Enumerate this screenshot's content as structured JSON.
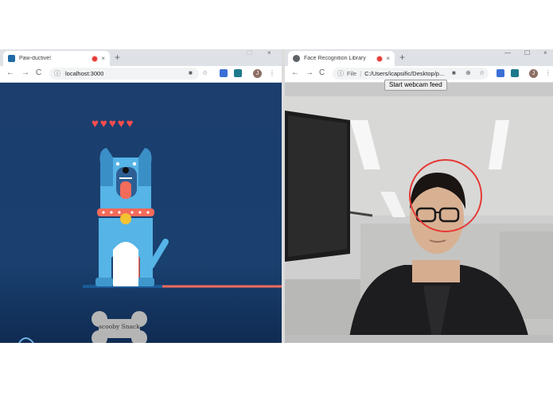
{
  "left_window": {
    "tab_title": "Paw-ductive!",
    "url": "localhost:3000",
    "avatar_letter": "J",
    "hearts": [
      "♥",
      "♥",
      "♥",
      "♥",
      "♥"
    ],
    "bone_label": "scooby Snack"
  },
  "right_window": {
    "tab_title": "Face Recognition Library",
    "url_prefix": "File",
    "url": "C:/Users/icapsific/Desktop/p...",
    "avatar_letter": "J",
    "webcam_button": "Start webcam feed"
  },
  "colors": {
    "left_background": "#1b3e6e",
    "face_circle": "#e53935",
    "heart": "#ff4d4d",
    "dog_body": "#56b4e6",
    "collar": "#f26b5b"
  },
  "icons": {
    "back": "←",
    "forward": "→",
    "reload": "C",
    "info": "ⓘ",
    "close": "×",
    "new_tab": "+",
    "menu": "⋮",
    "star": "☆",
    "camera": "■",
    "zoom": "⊕",
    "minimize": "—",
    "maximize": "☐"
  }
}
